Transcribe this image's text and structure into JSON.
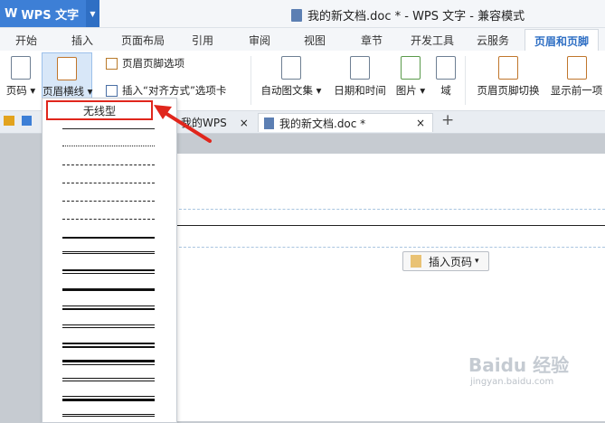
{
  "titlebar": {
    "app_logo": "W",
    "app_name": "WPS 文字",
    "window_title": "我的新文档.doc * - WPS 文字 - 兼容模式"
  },
  "tabs": [
    "开始",
    "插入",
    "页面布局",
    "引用",
    "审阅",
    "视图",
    "章节",
    "开发工具",
    "云服务",
    "页眉和页脚"
  ],
  "ribbon": {
    "page_number": "页码",
    "header_line": "页眉横线",
    "header_footer_options": "页眉页脚选项",
    "insert_align_tab": "插入“对齐方式”选项卡",
    "auto_text": "自动图文集",
    "date_time": "日期和时间",
    "picture": "图片",
    "field": "域",
    "switch_header_footer": "页眉页脚切换",
    "show_previous": "显示前一项"
  },
  "doc_tabs": {
    "my_wps": "我的WPS",
    "current_doc": "我的新文档.doc *",
    "new_tab": "+"
  },
  "dropdown": {
    "no_line": "无线型"
  },
  "document": {
    "insert_page_number": "插入页码"
  },
  "watermark": {
    "text": "Baidu 经验",
    "url": "jingyan.baidu.com"
  },
  "colors": {
    "accent": "#3d7fd6",
    "highlight_border": "#e0261c",
    "arrow": "#e0261c"
  }
}
